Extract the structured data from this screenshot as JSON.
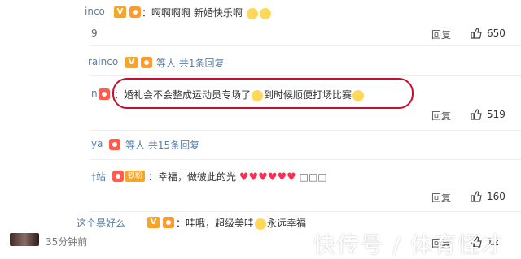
{
  "comments": [
    {
      "name": "inco",
      "text": "：啊啊啊啊 新婚快乐啊",
      "reply": "回复",
      "likes": "650",
      "ellipsis": "9"
    },
    {
      "name": "rainco",
      "sub": "等人 共1条回复"
    },
    {
      "name": "n",
      "text": "：婚礼会不会整成运动员专场了",
      "text2": "到时候顺便打场比赛",
      "reply": "回复",
      "likes": "519"
    },
    {
      "name": "ya",
      "sub": "等人 共15条回复"
    },
    {
      "name": "‡站",
      "badge": "铁粉",
      "text": "：幸福，做彼此的光",
      "tail": "□□□",
      "reply": "回复",
      "likes": "160"
    },
    {
      "name": "这个暴好么",
      "text": "：哇哦，超级美哇",
      "text2": "永远幸福",
      "reply": "回复",
      "likes": "12"
    }
  ],
  "footer": {
    "timestamp": "35分钟前"
  },
  "watermark": "快传号 / 体育怪才",
  "colors": {
    "highlight": "#c8102e",
    "link": "#5b7fa6",
    "vip": "#f7a529"
  }
}
